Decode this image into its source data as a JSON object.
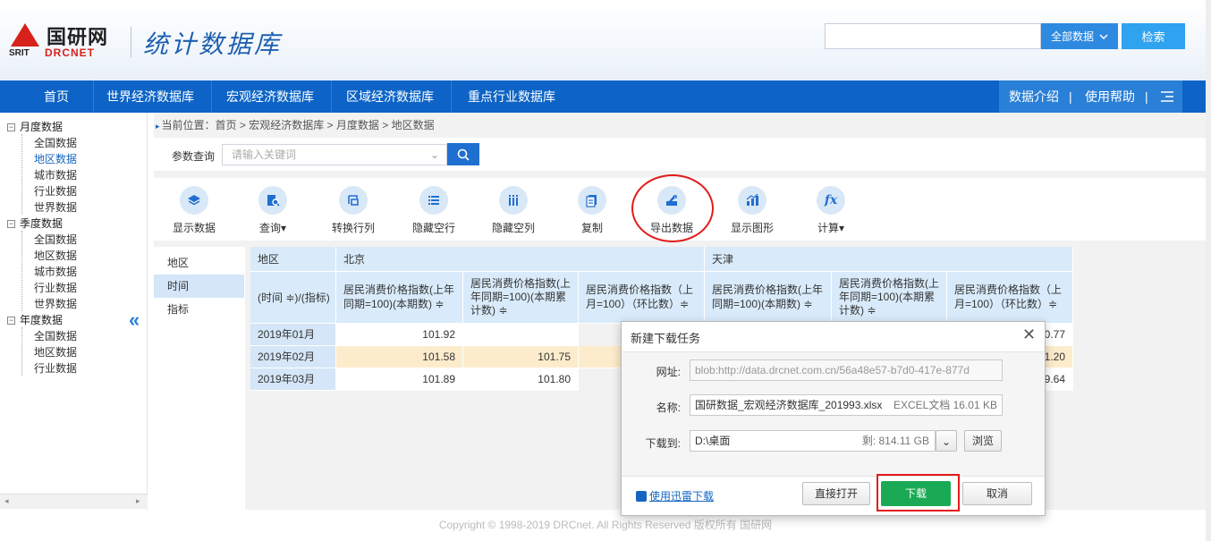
{
  "header": {
    "logo_cn": "国研网",
    "logo_en_left": "SRIT",
    "logo_en_right": "DRCNET",
    "site_title": "统计数据库",
    "search_placeholder": "",
    "search_scope": "全部数据",
    "search_button": "检索"
  },
  "nav": {
    "items": [
      "首页",
      "世界经济数据库",
      "宏观经济数据库",
      "区域经济数据库",
      "重点行业数据库"
    ],
    "right": [
      "数据介绍",
      "使用帮助"
    ],
    "separator": "|"
  },
  "sidebar": {
    "groups": [
      {
        "label": "月度数据",
        "items": [
          "全国数据",
          "地区数据",
          "城市数据",
          "行业数据",
          "世界数据"
        ]
      },
      {
        "label": "季度数据",
        "items": [
          "全国数据",
          "地区数据",
          "城市数据",
          "行业数据",
          "世界数据"
        ]
      },
      {
        "label": "年度数据",
        "items": [
          "全国数据",
          "地区数据",
          "行业数据"
        ]
      }
    ],
    "active_item": "地区数据",
    "minus": "−",
    "collapse": "«",
    "scroll_left": "◂",
    "scroll_right": "▸"
  },
  "breadcrumb": {
    "marker": "▸",
    "prefix": "当前位置：",
    "path": "首页 > 宏观经济数据库 > 月度数据 > 地区数据"
  },
  "query": {
    "label": "参数查询",
    "placeholder": "请输入关键词",
    "chevron": "⌄"
  },
  "toolbar": {
    "tools": [
      {
        "label": "显示数据",
        "icon": "layers-icon"
      },
      {
        "label": "查询▾",
        "icon": "query-icon"
      },
      {
        "label": "转换行列",
        "icon": "transpose-icon"
      },
      {
        "label": "隐藏空行",
        "icon": "hide-rows-icon"
      },
      {
        "label": "隐藏空列",
        "icon": "hide-cols-icon"
      },
      {
        "label": "复制",
        "icon": "copy-icon"
      },
      {
        "label": "导出数据",
        "icon": "export-icon"
      },
      {
        "label": "显示图形",
        "icon": "chart-icon"
      },
      {
        "label": "计算▾",
        "icon": "fx-icon"
      }
    ],
    "fx_glyph": "fx"
  },
  "dimensions": [
    "地区",
    "时间",
    "指标"
  ],
  "active_dimension": "时间",
  "table": {
    "corner_top": "地区",
    "corner_bottom": "(时间 ≑)/(指标)",
    "regions": [
      "北京",
      "天津"
    ],
    "columns": [
      "居民消费价格指数(上年同期=100)(本期数) ≑",
      "居民消费价格指数(上年同期=100)(本期累计数) ≑",
      "居民消费价格指数（上月=100）（环比数）≑",
      "居民消费价格指数(上年同期=100)(本期数) ≑",
      "居民消费价格指数(上年同期=100)(本期累计数) ≑",
      "居民消费价格指数（上月=100）（环比数）≑"
    ],
    "rows": [
      {
        "label": "2019年01月",
        "c1": "101.92",
        "c2": "",
        "c6": "100.77"
      },
      {
        "label": "2019年02月",
        "c1": "101.58",
        "c2": "101.75",
        "c6": "101.20"
      },
      {
        "label": "2019年03月",
        "c1": "101.89",
        "c2": "101.80",
        "c6": "99.64"
      }
    ]
  },
  "dialog": {
    "title": "新建下载任务",
    "close": "✕",
    "url_label": "网址:",
    "url_value": "blob:http://data.drcnet.com.cn/56a48e57-b7d0-417e-877d",
    "name_label": "名称:",
    "name_value": "国研数据_宏观经济数据库_201993.xlsx",
    "file_info": "EXCEL文档 16.01 KB",
    "save_label": "下载到:",
    "save_path": "D:\\桌面",
    "free_space": "剩: 814.11 GB",
    "dropdown": "⌄",
    "browse": "浏览",
    "xunlei": "使用迅雷下载",
    "open_direct": "直接打开",
    "download": "下载",
    "cancel": "取消"
  },
  "footer": "Copyright © 1998-2019 DRCnet. All Rights Reserved 版权所有 国研网"
}
